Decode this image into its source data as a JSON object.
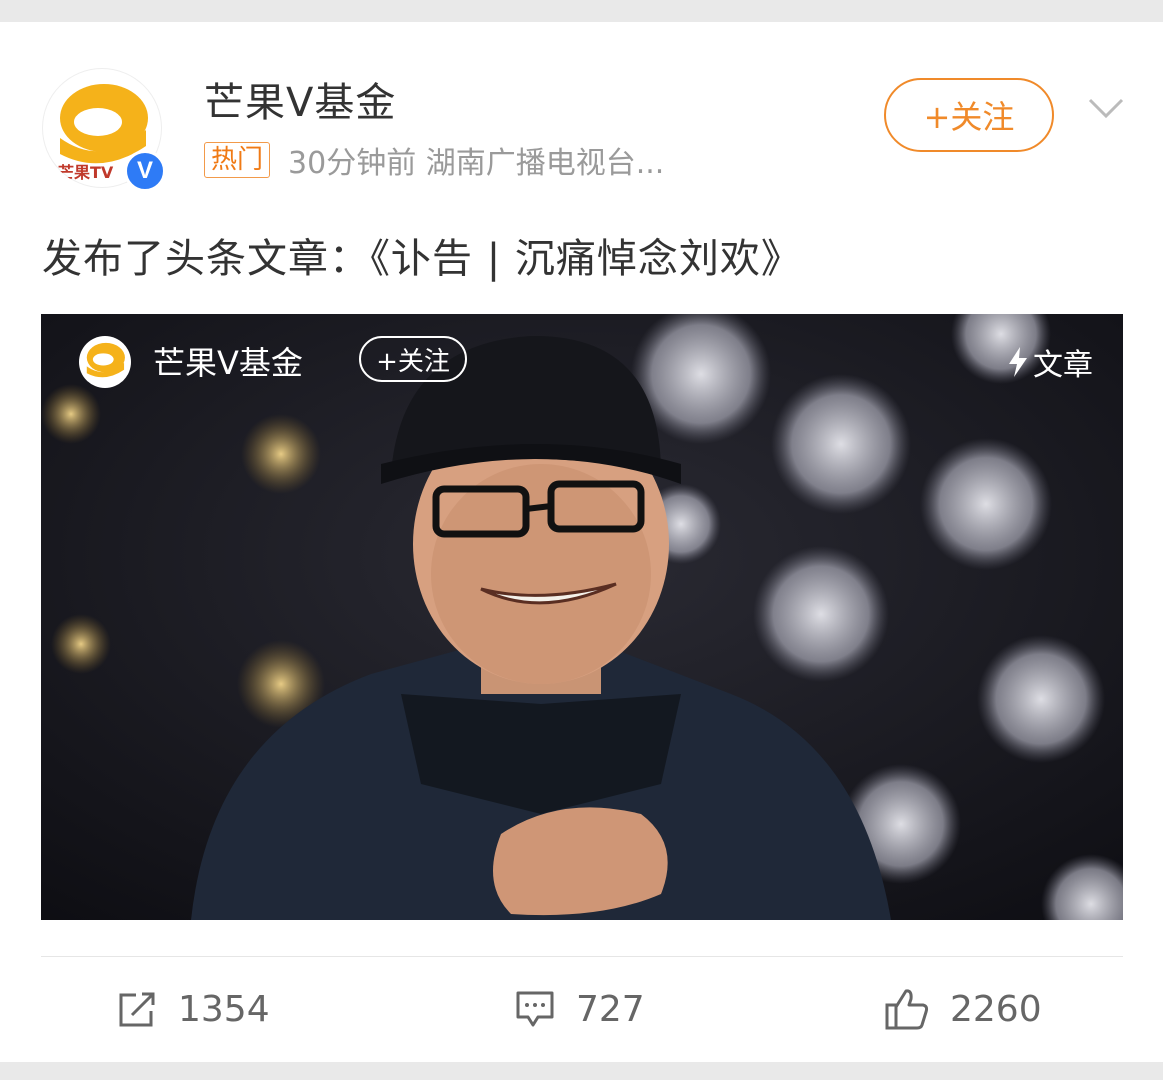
{
  "header": {
    "username": "芒果V基金",
    "hot_tag": "热门",
    "meta": "30分钟前  湖南广播电视台...",
    "follow_label": "+关注"
  },
  "post": {
    "text": "发布了头条文章：《讣告 | 沉痛悼念刘欢》"
  },
  "media": {
    "username": "芒果V基金",
    "follow_label": "+关注",
    "tag_label": "文章"
  },
  "actions": {
    "repost_count": "1354",
    "comment_count": "727",
    "like_count": "2260"
  },
  "icons": {
    "repost": "share-icon",
    "comment": "comment-icon",
    "like": "thumbs-up-icon",
    "verified": "verified-icon",
    "lightning": "lightning-icon",
    "more": "chevron-down-icon"
  },
  "colors": {
    "accent": "#f08a2a",
    "verified": "#2e7bf6"
  }
}
